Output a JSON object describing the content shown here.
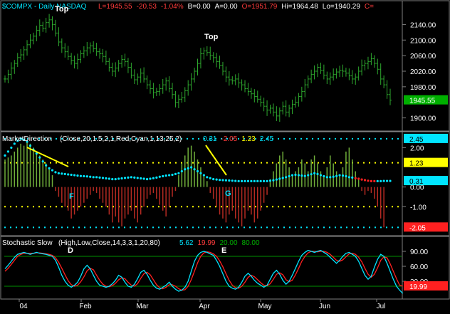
{
  "panels": {
    "price": {
      "title": "$COMPX - Daily NASDAQ",
      "stats": [
        {
          "text": "L=1945.55",
          "color": "#ff3b3b"
        },
        {
          "text": "-20.53",
          "color": "#ff3b3b"
        },
        {
          "text": "-1.04%",
          "color": "#ff3b3b"
        },
        {
          "text": "B=0.00",
          "color": "#ffffff"
        },
        {
          "text": "A=0.00",
          "color": "#ffffff"
        },
        {
          "text": "O=1951.79",
          "color": "#ff3b3b"
        },
        {
          "text": "Hi=1964.48",
          "color": "#ffffff"
        },
        {
          "text": "Lo=1940.29",
          "color": "#ffffff"
        },
        {
          "text": "C=",
          "color": "#ff3b3b"
        }
      ],
      "last_value": "1945.55"
    },
    "market_direction": {
      "title": "MarketDirection",
      "params": "(Close,20,1.5,2,1,Red,Cyan,1,13,25,2)",
      "readouts": [
        {
          "text": "0.31",
          "color": "#00e5ff"
        },
        {
          "text": "-2.05",
          "color": "#ff3b3b"
        },
        {
          "text": "1.23",
          "color": "#ffff00"
        },
        {
          "text": "2.45",
          "color": "#00e5ff"
        }
      ]
    },
    "stochastic": {
      "title": "Stochastic Slow",
      "params": "(High,Low,Close,14,3,3,1,20,80)",
      "readouts": [
        {
          "text": "5.62",
          "color": "#00e5ff"
        },
        {
          "text": "19.99",
          "color": "#ff3b3b"
        },
        {
          "text": "20.00",
          "color": "#00b000"
        },
        {
          "text": "80.00",
          "color": "#00b000"
        }
      ]
    }
  },
  "annotations": {
    "top1": "Top",
    "top2": "Top",
    "F": "F",
    "G": "G",
    "D": "D",
    "E": "E"
  },
  "x_labels": [
    "04",
    "Feb",
    "Mar",
    "Apr",
    "May",
    "Jun",
    "Jul"
  ],
  "colors": {
    "background": "#000000",
    "price_bars": "#2ea82e",
    "histogram_up": "#6fae3a",
    "histogram_down": "#b52a22",
    "cyan": "#00e5ff",
    "yellow": "#ffff00",
    "red": "#ff2020",
    "green_line": "#008f00"
  },
  "chart_data": [
    {
      "type": "ohlc",
      "name": "$COMPX daily",
      "y_ticks": [
        2140.0,
        2100.0,
        2060.0,
        2020.0,
        1980.0,
        1900.0
      ],
      "last_value_label": 1945.55,
      "ylim": [
        1870,
        2170
      ],
      "closes": [
        2000,
        2012,
        2028,
        2040,
        2055,
        2062,
        2075,
        2088,
        2100,
        2110,
        2125,
        2138,
        2130,
        2145,
        2152,
        2140,
        2118,
        2095,
        2080,
        2070,
        2058,
        2048,
        2040,
        2050,
        2065,
        2072,
        2080,
        2085,
        2078,
        2070,
        2065,
        2058,
        2045,
        2030,
        2020,
        2028,
        2040,
        2050,
        2045,
        2030,
        2010,
        1998,
        2005,
        2015,
        2000,
        1985,
        1975,
        1965,
        1968,
        1975,
        1985,
        1995,
        1975,
        1960,
        1940,
        1948,
        1952,
        1970,
        1985,
        2000,
        2020,
        2040,
        2065,
        2072,
        2068,
        2060,
        2055,
        2045,
        2035,
        2020,
        2005,
        1998,
        1995,
        2000,
        1990,
        1985,
        1975,
        1968,
        1962,
        1955,
        1948,
        1940,
        1930,
        1920,
        1925,
        1915,
        1905,
        1918,
        1930,
        1915,
        1925,
        1935,
        1940,
        1955,
        1968,
        1985,
        2000,
        2012,
        2020,
        2030,
        2022,
        2010,
        2000,
        2005,
        2012,
        2018,
        2022,
        2020,
        2015,
        2008,
        2000,
        2005,
        2020,
        2035,
        2040,
        2045,
        2052,
        2040,
        2025,
        2000,
        1985,
        1960,
        1945.55
      ]
    },
    {
      "type": "histogram",
      "name": "MarketDirection",
      "values_label": [
        0.31,
        -2.05,
        1.23,
        2.45
      ],
      "y_ticks": [
        2.0,
        0.0,
        -1.0
      ],
      "ylim": [
        -2.4,
        2.7
      ],
      "bars": [
        1.4,
        1.5,
        1.6,
        1.8,
        2.0,
        2.2,
        2.1,
        2.3,
        2.2,
        2.0,
        1.8,
        1.6,
        1.4,
        1.2,
        1.0,
        0.6,
        -0.2,
        -0.5,
        -0.8,
        -1.0,
        -1.2,
        -1.6,
        -1.4,
        -1.2,
        -1.0,
        -0.8,
        -0.6,
        -0.4,
        -0.2,
        -0.3,
        -0.6,
        -0.8,
        -1.0,
        -1.4,
        -1.8,
        -1.5,
        -1.8,
        -2.0,
        -1.6,
        -1.4,
        -1.2,
        -1.6,
        -1.8,
        -1.4,
        -1.0,
        -0.6,
        -0.4,
        -0.3,
        -0.6,
        -0.9,
        -1.2,
        -1.5,
        -1.0,
        -0.5,
        -0.2,
        0.6,
        1.2,
        1.6,
        2.0,
        2.1,
        1.8,
        1.4,
        1.0,
        0.6,
        0.3,
        -0.3,
        -0.6,
        -1.0,
        -1.4,
        -1.6,
        -1.8,
        -1.4,
        -1.2,
        -1.6,
        -1.8,
        -2.0,
        -1.6,
        -1.2,
        -1.4,
        -1.8,
        -1.6,
        -1.2,
        -0.8,
        -0.4,
        0.4,
        0.8,
        1.2,
        1.6,
        1.8,
        1.4,
        1.0,
        0.6,
        0.8,
        1.0,
        1.4,
        1.2,
        0.8,
        1.4,
        1.6,
        1.2,
        0.8,
        0.6,
        1.0,
        1.6,
        1.2,
        0.8,
        0.6,
        1.0,
        1.8,
        2.0,
        1.4,
        0.8,
        0.4,
        -0.2,
        -0.4,
        -0.2,
        -0.3,
        -0.6,
        -1.0,
        -1.6,
        -2.05
      ],
      "dots": [
        1.6,
        1.8,
        2.0,
        2.2,
        2.35,
        2.45,
        2.4,
        2.3,
        2.1,
        1.9,
        1.7,
        1.5,
        1.3,
        1.1,
        0.95,
        0.85,
        0.75,
        0.7,
        0.68,
        0.66,
        0.64,
        0.62,
        0.6,
        0.58,
        0.56,
        0.55,
        0.54,
        0.52,
        0.5,
        0.5,
        0.48,
        0.46,
        0.44,
        0.42,
        0.4,
        0.4,
        0.42,
        0.44,
        0.46,
        0.48,
        0.5,
        0.48,
        0.46,
        0.44,
        0.42,
        0.4,
        0.42,
        0.45,
        0.48,
        0.52,
        0.55,
        0.58,
        0.6,
        0.62,
        0.66,
        0.7,
        0.8,
        0.9,
        0.95,
        1.0,
        0.9,
        0.8,
        0.7,
        0.6,
        0.5,
        0.45,
        0.4,
        0.38,
        0.36,
        0.35,
        0.34,
        0.33,
        0.32,
        0.31,
        0.3,
        0.3,
        0.3,
        0.3,
        0.3,
        0.3,
        0.3,
        0.3,
        0.3,
        0.3,
        0.32,
        0.34,
        0.38,
        0.42,
        0.46,
        0.5,
        0.55,
        0.6,
        0.62,
        0.6,
        0.58,
        0.56,
        0.6,
        0.65,
        0.7,
        0.66,
        0.6,
        0.55,
        0.5,
        0.5,
        0.52,
        0.56,
        0.6,
        0.58,
        0.55,
        0.5,
        0.48,
        0.45,
        0.42,
        0.38,
        0.35,
        0.32,
        0.3,
        0.3,
        0.3,
        0.3,
        0.31,
        0.31,
        0.31
      ],
      "bands": [
        2.45,
        1.23,
        -1.0,
        -2.05
      ]
    },
    {
      "type": "line",
      "name": "Stochastic Slow",
      "y_ticks": [
        90.0,
        60.0,
        30.0
      ],
      "value_label": 19.99,
      "ylim": [
        0,
        100
      ],
      "reference_lines": [
        20.0,
        80.0
      ],
      "k": [
        55,
        62,
        70,
        78,
        84,
        86,
        88,
        86,
        84,
        86,
        88,
        86,
        85,
        84,
        82,
        80,
        72,
        58,
        42,
        30,
        22,
        18,
        22,
        28,
        40,
        55,
        62,
        55,
        42,
        30,
        22,
        20,
        18,
        20,
        25,
        32,
        42,
        38,
        28,
        20,
        18,
        24,
        35,
        48,
        52,
        44,
        32,
        22,
        16,
        14,
        18,
        22,
        28,
        20,
        14,
        10,
        12,
        18,
        30,
        50,
        70,
        82,
        88,
        90,
        88,
        85,
        82,
        72,
        60,
        45,
        30,
        20,
        16,
        14,
        18,
        28,
        40,
        46,
        40,
        32,
        26,
        22,
        18,
        22,
        34,
        46,
        52,
        44,
        32,
        24,
        30,
        42,
        56,
        70,
        82,
        88,
        92,
        90,
        88,
        90,
        92,
        88,
        84,
        78,
        72,
        66,
        72,
        80,
        86,
        88,
        84,
        80,
        70,
        56,
        42,
        34,
        40,
        58,
        74,
        84,
        80,
        66,
        50,
        34,
        20,
        12,
        5.62
      ],
      "d": [
        50,
        56,
        64,
        72,
        80,
        84,
        86,
        86,
        86,
        86,
        87,
        87,
        86,
        85,
        84,
        82,
        77,
        68,
        56,
        43,
        31,
        23,
        20,
        22,
        29,
        39,
        51,
        56,
        53,
        42,
        32,
        24,
        20,
        19,
        21,
        26,
        33,
        37,
        35,
        28,
        22,
        20,
        25,
        36,
        45,
        48,
        43,
        33,
        23,
        17,
        15,
        18,
        23,
        23,
        20,
        15,
        12,
        13,
        20,
        33,
        50,
        67,
        80,
        87,
        89,
        88,
        85,
        80,
        71,
        59,
        45,
        32,
        22,
        17,
        16,
        20,
        28,
        38,
        42,
        39,
        33,
        27,
        22,
        21,
        25,
        34,
        44,
        47,
        43,
        33,
        29,
        32,
        43,
        56,
        70,
        80,
        87,
        90,
        90,
        89,
        90,
        90,
        88,
        84,
        78,
        72,
        70,
        73,
        79,
        85,
        86,
        84,
        78,
        69,
        56,
        44,
        38,
        44,
        57,
        72,
        79,
        77,
        65,
        50,
        35,
        22,
        19.99
      ]
    }
  ]
}
